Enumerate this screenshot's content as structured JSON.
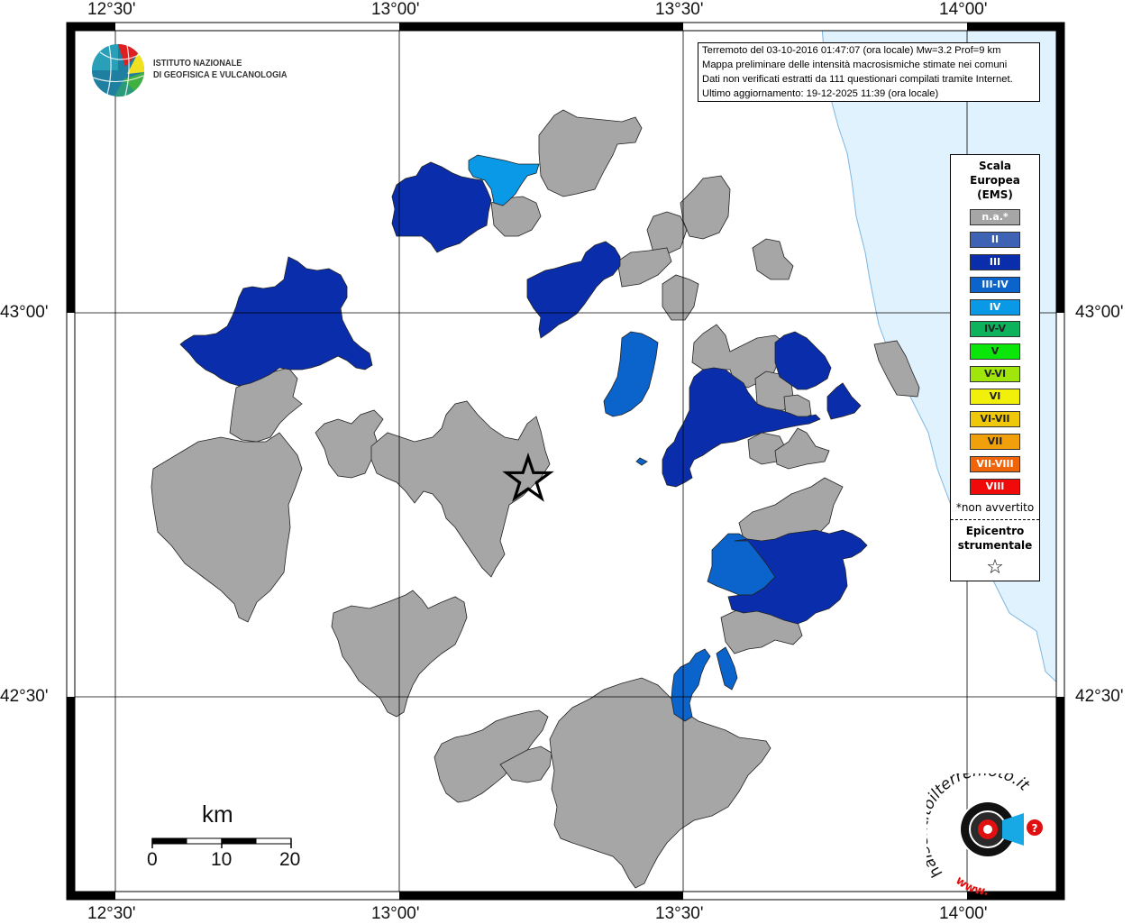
{
  "map": {
    "ticks": {
      "lon": [
        {
          "label": "12°30'"
        },
        {
          "label": "13°00'"
        },
        {
          "label": "13°30'"
        },
        {
          "label": "14°00'"
        }
      ],
      "lat": [
        {
          "label": "43°00'"
        },
        {
          "label": "42°30'"
        }
      ]
    },
    "colors": {
      "na": "#a6a6a6",
      "III": "#0a2eab",
      "III_IV": "#0a64cc",
      "IV": "#0a99e6",
      "sea": "#e0f2fd",
      "border": "#000000"
    },
    "epicenter_marker": "star-icon"
  },
  "logo": {
    "line1": "ISTITUTO NAZIONALE",
    "line2": "DI GEOFISICA E VULCANOLOGIA",
    "icon": "globe-icon"
  },
  "info": {
    "line1": "Terremoto del 03-10-2016 01:47:07 (ora locale) Mw=3.2 Prof=9 km",
    "line2": "Mappa preliminare delle intensità macrosismiche stimate nei comuni",
    "line3": "Dati non verificati estratti da 111 questionari compilati tramite Internet.",
    "line4": "Ultimo aggiornamento: 19-12-2025 11:39 (ora locale)"
  },
  "legend": {
    "title1": "Scala",
    "title2": "Europea",
    "title3": "(EMS)",
    "items": [
      {
        "label": "n.a.*",
        "color": "#a6a6a6"
      },
      {
        "label": "II",
        "color": "#3f63b4"
      },
      {
        "label": "III",
        "color": "#0a2eab"
      },
      {
        "label": "III-IV",
        "color": "#0a64cc"
      },
      {
        "label": "IV",
        "color": "#0a99e6"
      },
      {
        "label": "IV-V",
        "color": "#0db25c"
      },
      {
        "label": "V",
        "color": "#0ae60a"
      },
      {
        "label": "V-VI",
        "color": "#a0e60a"
      },
      {
        "label": "VI",
        "color": "#f0f00a"
      },
      {
        "label": "VI-VII",
        "color": "#f0c80a"
      },
      {
        "label": "VII",
        "color": "#f0a00a"
      },
      {
        "label": "VII-VIII",
        "color": "#f0640a"
      },
      {
        "label": "VIII",
        "color": "#f00a0a"
      }
    ],
    "note": "*non avvertito",
    "epicentro1": "Epicentro",
    "epicentro2": "strumentale",
    "star": "☆"
  },
  "scalebar": {
    "title": "km",
    "labels": [
      "0",
      "10",
      "20"
    ]
  },
  "hsi_logo": {
    "text": "haisentitoilterremoto.it",
    "prefix": "www.",
    "icon": "seismometer-icon"
  }
}
